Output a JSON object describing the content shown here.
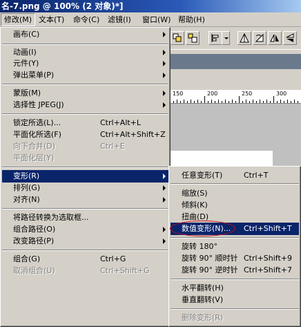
{
  "window": {
    "title": "名-7.png @ 100% (2 对象)*]"
  },
  "menubar": {
    "items": [
      "修改(M)",
      "文本(T)",
      "命令(C)",
      "滤镜(I)",
      "窗口(W)",
      "帮助(H)"
    ]
  },
  "modify_menu": {
    "items": [
      {
        "label": "画布(C)",
        "shortcut": "",
        "submenu": true,
        "disabled": false
      },
      {
        "label": "动画(I)",
        "shortcut": "",
        "submenu": true,
        "disabled": false
      },
      {
        "label": "元件(Y)",
        "shortcut": "",
        "submenu": true,
        "disabled": false
      },
      {
        "label": "弹出菜单(P)",
        "shortcut": "",
        "submenu": true,
        "disabled": false
      },
      {
        "label": "蒙版(M)",
        "shortcut": "",
        "submenu": true,
        "disabled": false
      },
      {
        "label": "选择性 JPEG(J)",
        "shortcut": "",
        "submenu": true,
        "disabled": false
      },
      {
        "label": "锁定所选(L)...",
        "shortcut": "Ctrl+Alt+L",
        "submenu": false,
        "disabled": false
      },
      {
        "label": "平面化所选(F)",
        "shortcut": "Ctrl+Alt+Shift+Z",
        "submenu": false,
        "disabled": false
      },
      {
        "label": "向下合并(D)",
        "shortcut": "Ctrl+E",
        "submenu": false,
        "disabled": true
      },
      {
        "label": "平面化层(Y)",
        "shortcut": "",
        "submenu": false,
        "disabled": true
      },
      {
        "label": "变形(R)",
        "shortcut": "",
        "submenu": true,
        "disabled": false
      },
      {
        "label": "排列(G)",
        "shortcut": "",
        "submenu": true,
        "disabled": false
      },
      {
        "label": "对齐(N)",
        "shortcut": "",
        "submenu": true,
        "disabled": false
      },
      {
        "label": "将路径转换为选取框...",
        "shortcut": "",
        "submenu": false,
        "disabled": false
      },
      {
        "label": "组合路径(O)",
        "shortcut": "",
        "submenu": true,
        "disabled": false
      },
      {
        "label": "改变路径(P)",
        "shortcut": "",
        "submenu": true,
        "disabled": false
      },
      {
        "label": "组合(G)",
        "shortcut": "Ctrl+G",
        "submenu": false,
        "disabled": false
      },
      {
        "label": "取消组合(U)",
        "shortcut": "Ctrl+Shift+G",
        "submenu": false,
        "disabled": true
      }
    ]
  },
  "transform_menu": {
    "items": [
      {
        "label": "任意变形(T)",
        "shortcut": "Ctrl+T",
        "disabled": false
      },
      {
        "label": "缩放(S)",
        "shortcut": "",
        "disabled": false
      },
      {
        "label": "倾斜(K)",
        "shortcut": "",
        "disabled": false
      },
      {
        "label": "扭曲(D)",
        "shortcut": "",
        "disabled": false
      },
      {
        "label": "数值变形(N)...",
        "shortcut": "Ctrl+Shift+T",
        "disabled": false
      },
      {
        "label": "旋转 180°",
        "shortcut": "",
        "disabled": false
      },
      {
        "label": "旋转 90° 顺时针",
        "shortcut": "Ctrl+Shift+9",
        "disabled": false
      },
      {
        "label": "旋转 90° 逆时针",
        "shortcut": "Ctrl+Shift+7",
        "disabled": false
      },
      {
        "label": "水平翻转(H)",
        "shortcut": "",
        "disabled": false
      },
      {
        "label": "垂直翻转(V)",
        "shortcut": "",
        "disabled": false
      },
      {
        "label": "删除变形(R)",
        "shortcut": "",
        "disabled": true
      }
    ]
  },
  "ruler": {
    "labels": [
      "150",
      "200",
      "250",
      "300"
    ]
  },
  "colors": {
    "menu_highlight": "#0a246a",
    "title_gradient_start": "#0a246a",
    "shape_fill": "#ee0000",
    "annotation_ellipse": "#d01010"
  }
}
